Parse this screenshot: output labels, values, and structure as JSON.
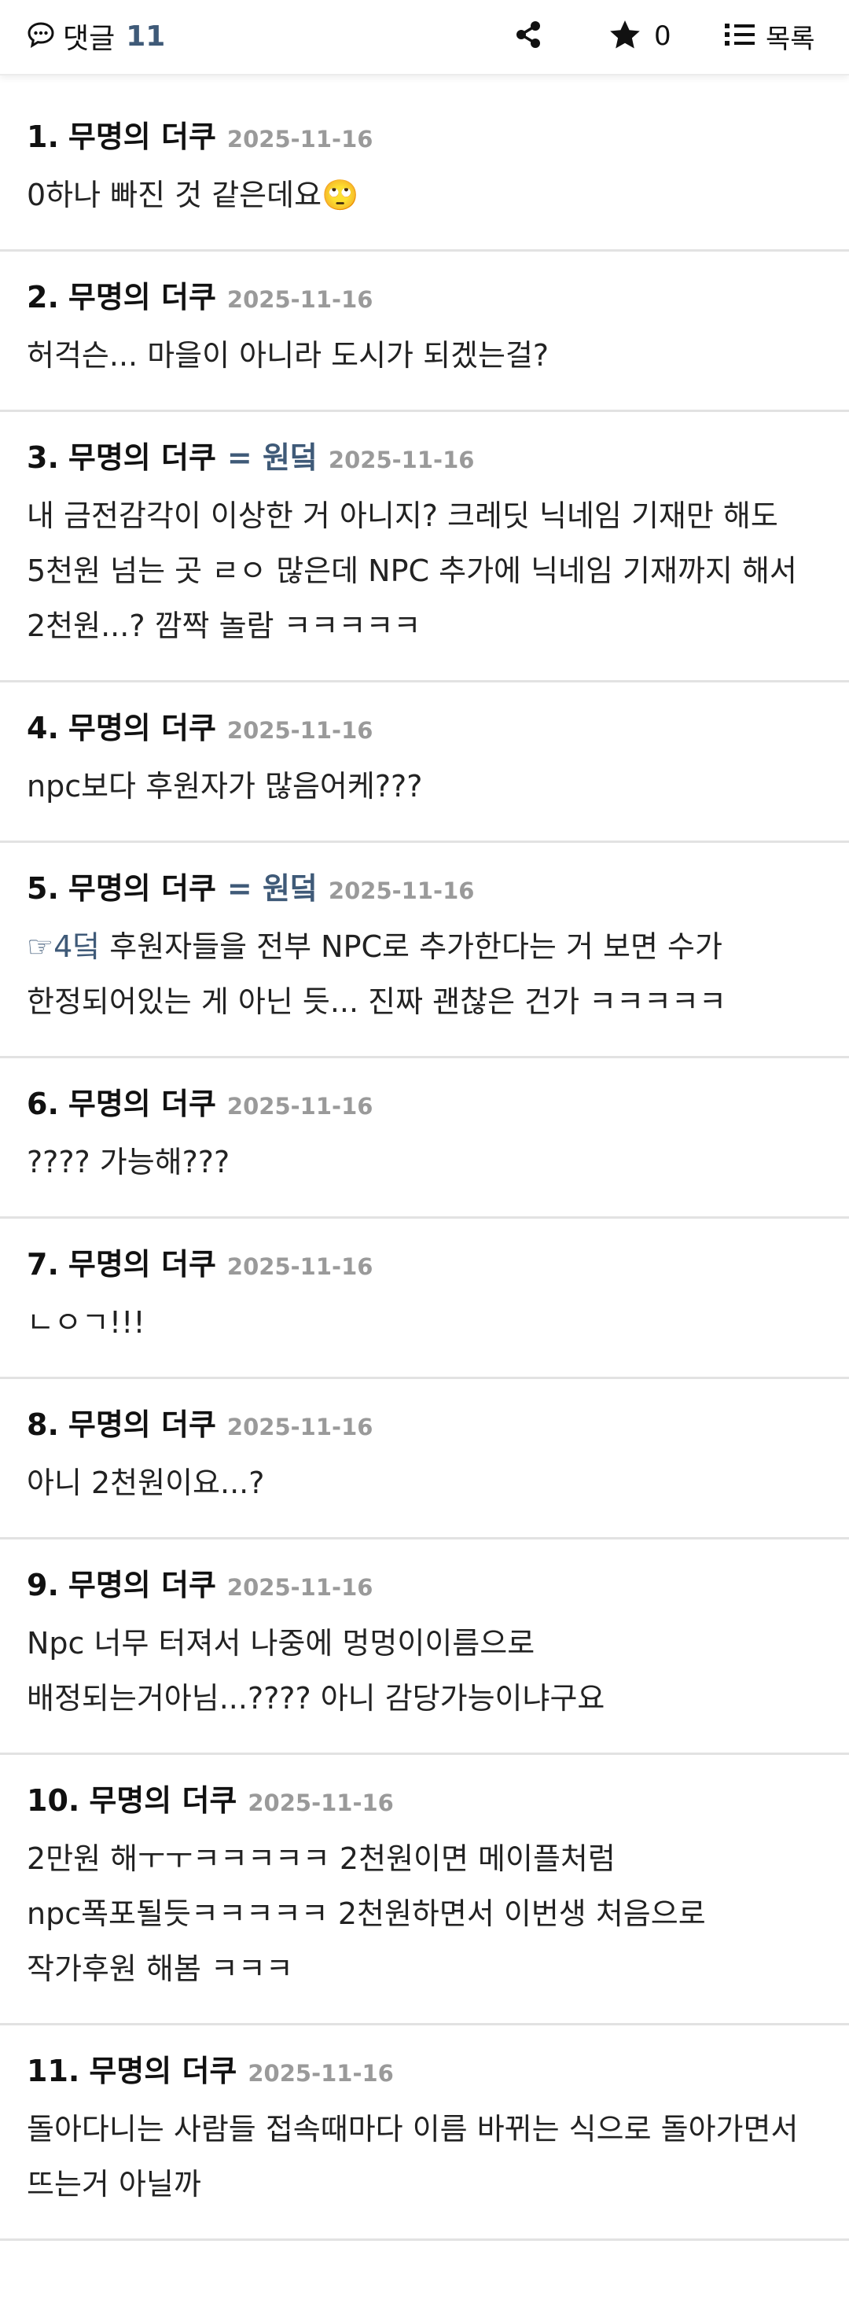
{
  "header": {
    "comments_label": "댓글",
    "comments_count": "11",
    "star_count": "0",
    "list_label": "목록"
  },
  "comments": [
    {
      "num": "1",
      "author": "무명의 더쿠",
      "tag": "",
      "date": "2025-11-16",
      "ref": "",
      "text": "0하나 빠진 것 같은데요🙄"
    },
    {
      "num": "2",
      "author": "무명의 더쿠",
      "tag": "",
      "date": "2025-11-16",
      "ref": "",
      "text": "허걱슨... 마을이 아니라 도시가 되겠는걸?"
    },
    {
      "num": "3",
      "author": "무명의 더쿠",
      "tag": "= 원덬",
      "date": "2025-11-16",
      "ref": "",
      "text": "내 금전감각이 이상한 거 아니지? 크레딧 닉네임 기재만 해도 5천원 넘는 곳 ㄹㅇ 많은데 NPC 추가에 닉네임 기재까지 해서 2천원...? 깜짝 놀람 ㅋㅋㅋㅋㅋ"
    },
    {
      "num": "4",
      "author": "무명의 더쿠",
      "tag": "",
      "date": "2025-11-16",
      "ref": "",
      "text": "npc보다 후원자가 많음어케???"
    },
    {
      "num": "5",
      "author": "무명의 더쿠",
      "tag": "= 원덬",
      "date": "2025-11-16",
      "ref": "☞4덬",
      "text": " 후원자들을 전부 NPC로 추가한다는 거 보면 수가 한정되어있는 게 아닌 듯... 진짜 괜찮은 건가 ㅋㅋㅋㅋㅋ"
    },
    {
      "num": "6",
      "author": "무명의 더쿠",
      "tag": "",
      "date": "2025-11-16",
      "ref": "",
      "text": "???? 가능해???"
    },
    {
      "num": "7",
      "author": "무명의 더쿠",
      "tag": "",
      "date": "2025-11-16",
      "ref": "",
      "text": "ㄴㅇㄱ!!!"
    },
    {
      "num": "8",
      "author": "무명의 더쿠",
      "tag": "",
      "date": "2025-11-16",
      "ref": "",
      "text": "아니 2천원이요...?"
    },
    {
      "num": "9",
      "author": "무명의 더쿠",
      "tag": "",
      "date": "2025-11-16",
      "ref": "",
      "text": "Npc 너무 터져서 나중에 멍멍이이름으로 배정되는거아님...???? 아니 감당가능이냐구요"
    },
    {
      "num": "10",
      "author": "무명의 더쿠",
      "tag": "",
      "date": "2025-11-16",
      "ref": "",
      "text": "2만원 해ㅜㅜㅋㅋㅋㅋㅋ 2천원이면 메이플처럼 npc폭포될듯ㅋㅋㅋㅋㅋ 2천원하면서 이번생 처음으로 작가후원 해봄 ㅋㅋㅋ"
    },
    {
      "num": "11",
      "author": "무명의 더쿠",
      "tag": "",
      "date": "2025-11-16",
      "ref": "",
      "text": "돌아다니는 사람들 접속때마다 이름 바뀌는 식으로 돌아가면서 뜨는거 아닐까"
    }
  ]
}
